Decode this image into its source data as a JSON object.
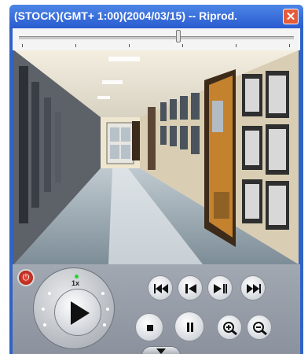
{
  "window": {
    "title": "(STOCK)(GMT+ 1:00)(2004/03/15) -- Riprod.",
    "close_icon": "close-icon",
    "colors": {
      "titlebar": "#2f63c6",
      "close": "#e55c3a"
    }
  },
  "seek": {
    "position": 0.58
  },
  "video": {
    "description_icon": "camera-feed"
  },
  "controls": {
    "speed_label": "1x",
    "icons": {
      "power": "power-icon",
      "play": "play-icon",
      "skip_start": "skip-to-start-icon",
      "step_back": "step-back-icon",
      "play_pause": "play-pause-icon",
      "skip_end": "skip-to-end-icon",
      "stop": "stop-icon",
      "pause": "pause-icon",
      "zoom_in": "zoom-in-icon",
      "zoom_out": "zoom-out-icon",
      "expand": "expand-icon"
    }
  }
}
